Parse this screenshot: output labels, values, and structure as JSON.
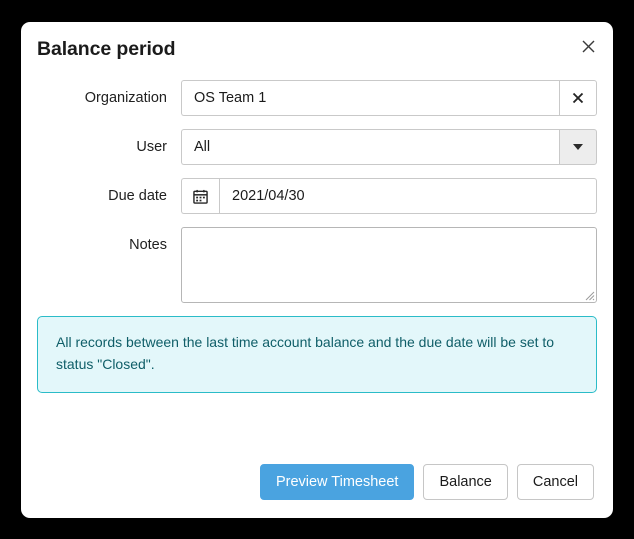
{
  "dialog": {
    "title": "Balance period",
    "close_icon": "close-icon"
  },
  "form": {
    "organization": {
      "label": "Organization",
      "value": "OS Team 1",
      "clear_icon": "✕"
    },
    "user": {
      "label": "User",
      "value": "All",
      "dropdown_icon": "chevron-down-icon"
    },
    "due_date": {
      "label": "Due date",
      "value": "2021/04/30",
      "calendar_icon": "calendar-icon"
    },
    "notes": {
      "label": "Notes",
      "value": "",
      "placeholder": ""
    }
  },
  "info": {
    "message": "All records between the last time account balance and the due date will be set to status \"Closed\".",
    "border_color": "#2bbcc8",
    "background_color": "#e3f7fa",
    "text_color": "#0f5e68"
  },
  "footer": {
    "preview_label": "Preview Timesheet",
    "balance_label": "Balance",
    "cancel_label": "Cancel",
    "primary_color": "#4aa3e0"
  }
}
